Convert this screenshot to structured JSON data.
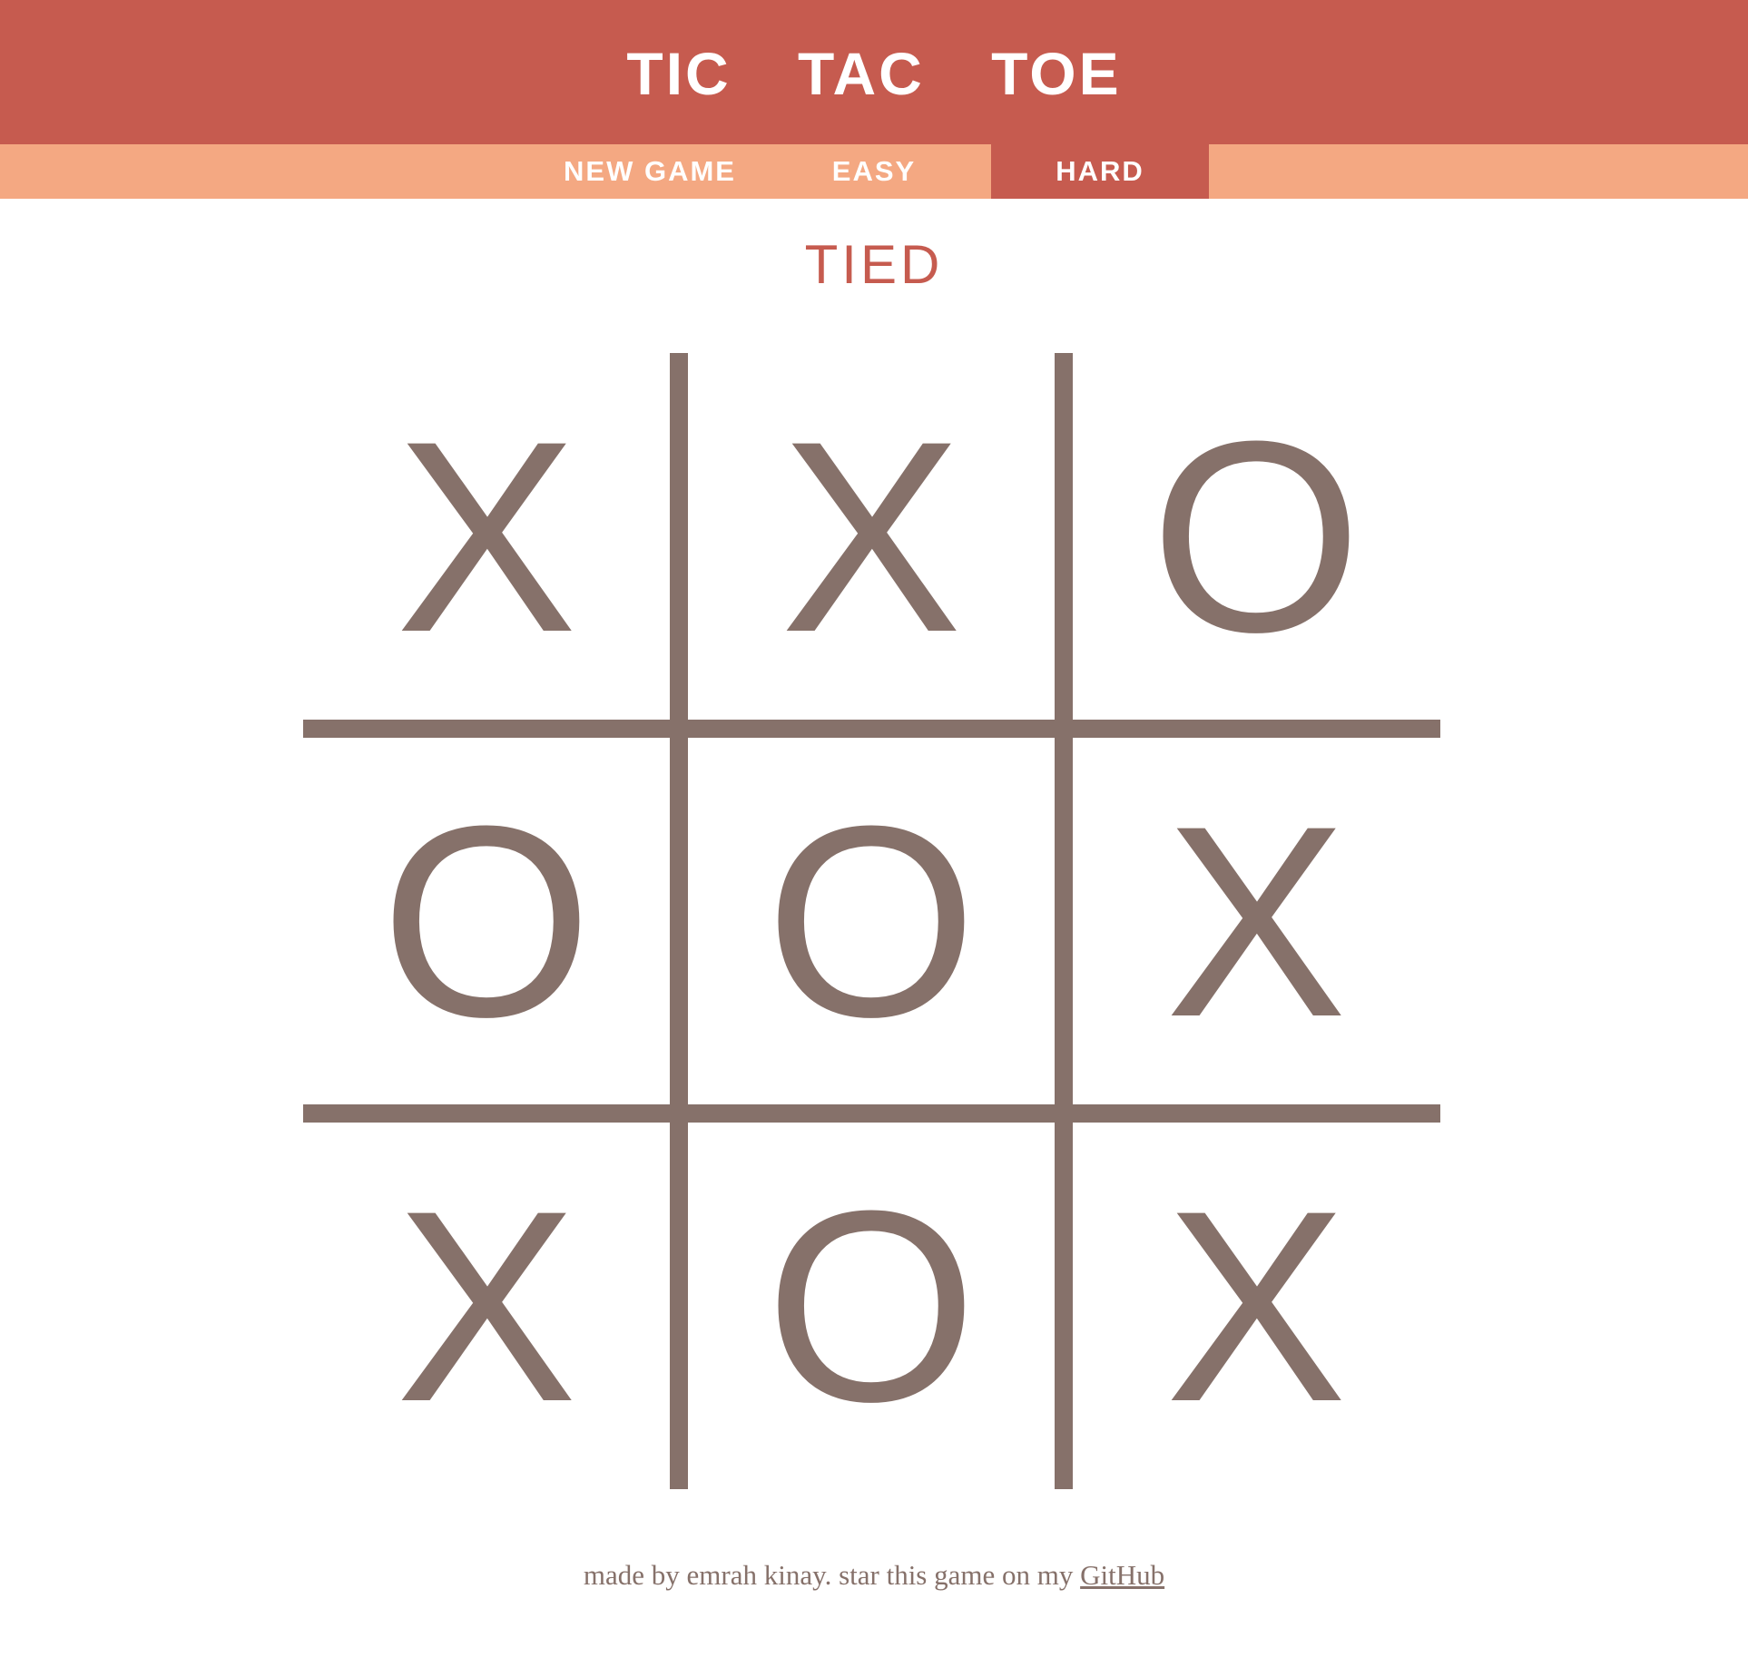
{
  "header": {
    "title": "TIC TAC TOE"
  },
  "menu": {
    "new_game": "NEW GAME",
    "easy": "EASY",
    "hard": "HARD",
    "active": "HARD"
  },
  "status": "TIED",
  "board": {
    "cells": [
      "X",
      "X",
      "O",
      "O",
      "O",
      "X",
      "X",
      "O",
      "X"
    ]
  },
  "footer": {
    "text": "made by emrah kinay. star this game on my ",
    "link_label": "GitHub"
  },
  "colors": {
    "header": "#c65b4f",
    "menu": "#f4a882",
    "active_menu": "#c65b4f",
    "marks": "#86716a",
    "status": "#c65b4f"
  }
}
